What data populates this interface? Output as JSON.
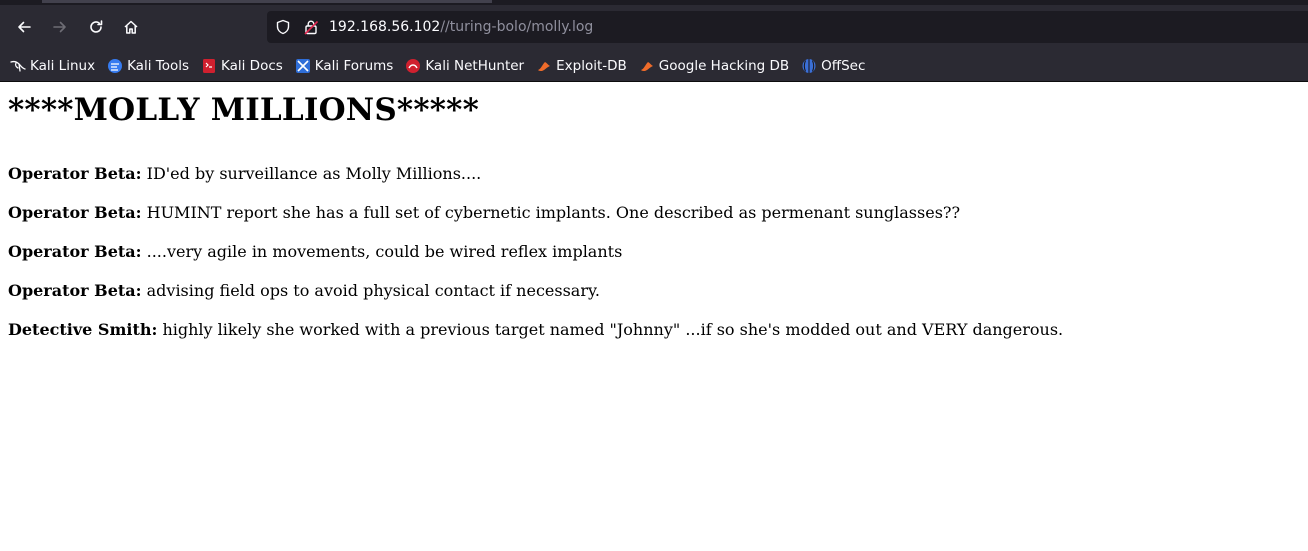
{
  "browser": {
    "url_host": "192.168.56.102",
    "url_path": "//turing-bolo/molly.log",
    "bookmarks": [
      {
        "label": "Kali Linux",
        "icon": "kali-dragon-icon"
      },
      {
        "label": "Kali Tools",
        "icon": "kali-tools-icon"
      },
      {
        "label": "Kali Docs",
        "icon": "kali-docs-icon"
      },
      {
        "label": "Kali Forums",
        "icon": "kali-forums-icon"
      },
      {
        "label": "Kali NetHunter",
        "icon": "nethunter-icon"
      },
      {
        "label": "Exploit-DB",
        "icon": "exploit-db-icon"
      },
      {
        "label": "Google Hacking DB",
        "icon": "ghdb-icon"
      },
      {
        "label": "OffSec",
        "icon": "offsec-icon"
      }
    ]
  },
  "page": {
    "title": "****MOLLY MILLIONS*****",
    "entries": [
      {
        "speaker": "Operator Beta:",
        "text": " ID'ed by surveillance as Molly Millions...."
      },
      {
        "speaker": "Operator Beta:",
        "text": " HUMINT report she has a full set of cybernetic implants. One described as permenant sunglasses??"
      },
      {
        "speaker": "Operator Beta:",
        "text": " ....very agile in movements, could be wired reflex implants"
      },
      {
        "speaker": "Operator Beta:",
        "text": " advising field ops to avoid physical contact if necessary."
      },
      {
        "speaker": "Detective Smith:",
        "text": " highly likely she worked with a previous target named \"Johnny\" ...if so she's modded out and VERY dangerous."
      }
    ]
  },
  "colors": {
    "toolbar_bg": "#2b2a33",
    "urlbar_bg": "#1c1b22",
    "text_light": "#fbfbfe",
    "url_path": "#8f8f9d"
  }
}
